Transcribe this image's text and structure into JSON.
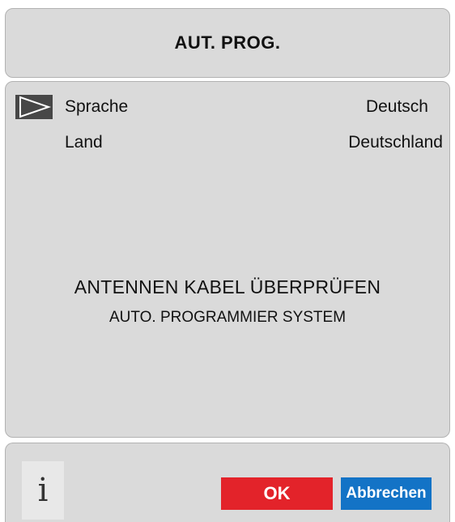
{
  "header": {
    "title": "AUT. PROG."
  },
  "settings": {
    "items": [
      {
        "label": "Sprache",
        "value": "Deutsch"
      },
      {
        "label": "Land",
        "value": "Deutschland"
      }
    ]
  },
  "message": {
    "line1": "ANTENNEN KABEL ÜBERPRÜFEN",
    "line2": "AUTO. PROGRAMMIER SYSTEM"
  },
  "footer": {
    "info_icon": "info-icon",
    "info_glyph": "i",
    "ok_label": "OK",
    "cancel_label": "Abbrechen"
  },
  "colors": {
    "panel": "#dadada",
    "ok": "#e3232a",
    "cancel": "#1373c6",
    "cursor": "#474747"
  }
}
